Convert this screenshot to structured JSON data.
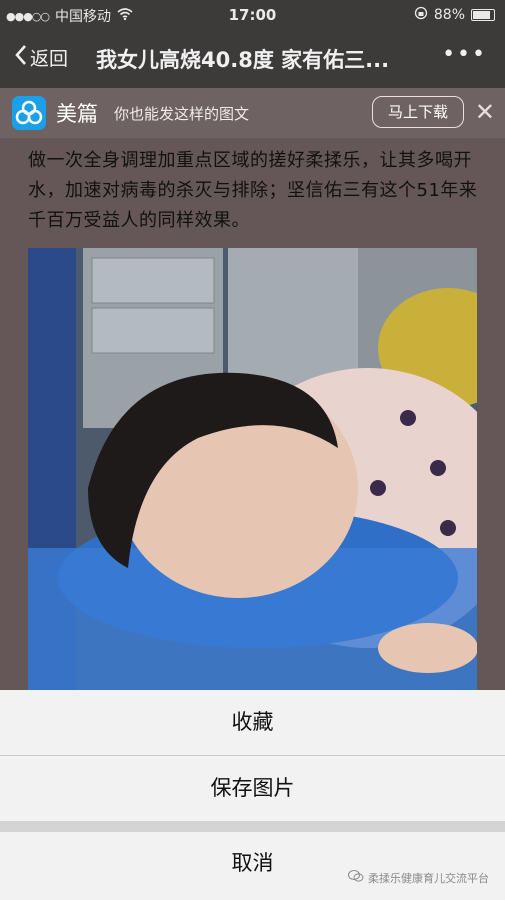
{
  "status_bar": {
    "carrier": "中国移动",
    "time": "17:00",
    "battery": "88%"
  },
  "nav": {
    "back_label": "返回",
    "title": "我女儿高烧40.8度 家有佑三..."
  },
  "banner": {
    "app_name": "美篇",
    "slogan": "你也能发这样的图文",
    "download_label": "马上下载"
  },
  "article": {
    "paragraph": "做一次全身调理加重点区域的搓好柔揉乐，让其多喝开水，加速对病毒的杀灭与排除；坚信佑三有这个51年来千百万受益人的同样效果。"
  },
  "action_sheet": {
    "favorite": "收藏",
    "save_image": "保存图片",
    "cancel": "取消"
  },
  "watermark": "柔揉乐健康育儿交流平台",
  "colors": {
    "accent": "#1aa0e8",
    "sheet_bg": "#f2f2f2"
  },
  "icons": [
    "signal-dots-icon",
    "wifi-icon",
    "lock-rotation-icon",
    "battery-icon",
    "back-chevron-icon",
    "more-icon",
    "meipian-logo-icon",
    "close-icon",
    "wechat-icon"
  ]
}
